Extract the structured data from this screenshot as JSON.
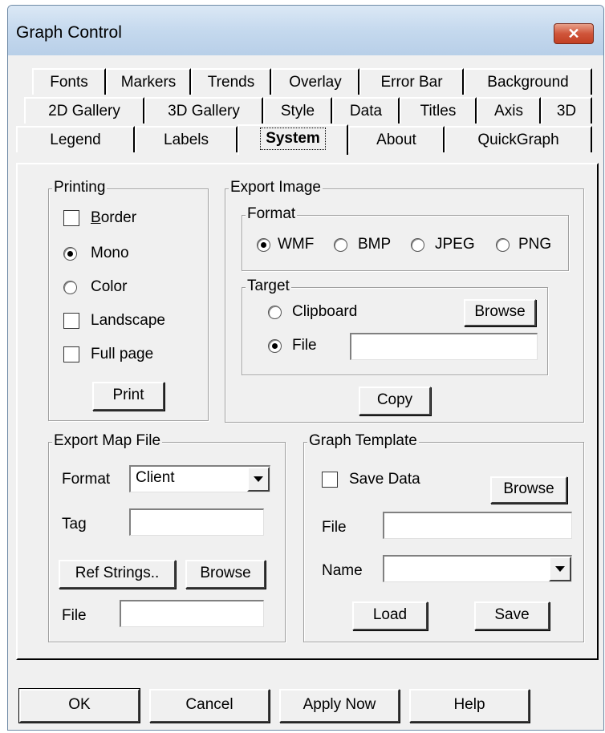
{
  "window": {
    "title": "Graph Control",
    "close_glyph": "✕"
  },
  "tabs": {
    "row1": [
      "Fonts",
      "Markers",
      "Trends",
      "Overlay",
      "Error Bar",
      "Background"
    ],
    "row2": [
      "2D Gallery",
      "3D Gallery",
      "Style",
      "Data",
      "Titles",
      "Axis",
      "3D"
    ],
    "row3": [
      "Legend",
      "Labels",
      "System",
      "About",
      "QuickGraph"
    ],
    "active": "System"
  },
  "printing": {
    "title": "Printing",
    "border": {
      "label": "Border",
      "checked": false
    },
    "mono": {
      "label": "Mono",
      "selected": true
    },
    "color": {
      "label": "Color",
      "selected": false
    },
    "landscape": {
      "label": "Landscape",
      "checked": false
    },
    "full_page": {
      "label": "Full page",
      "checked": false
    },
    "print_button": "Print"
  },
  "export_image": {
    "title": "Export Image",
    "format_title": "Format",
    "formats": [
      "WMF",
      "BMP",
      "JPEG",
      "PNG"
    ],
    "selected_format": "WMF",
    "target_title": "Target",
    "clipboard_label": "Clipboard",
    "file_label": "File",
    "selected_target": "File",
    "file_value": "",
    "browse_button": "Browse",
    "copy_button": "Copy"
  },
  "export_map": {
    "title": "Export Map File",
    "format_label": "Format",
    "format_value": "Client",
    "tag_label": "Tag",
    "tag_value": "",
    "ref_strings_button": "Ref Strings..",
    "browse_button": "Browse",
    "file_label": "File",
    "file_value": ""
  },
  "graph_template": {
    "title": "Graph Template",
    "save_data_label": "Save Data",
    "save_data_checked": false,
    "browse_button": "Browse",
    "file_label": "File",
    "file_value": "",
    "name_label": "Name",
    "name_value": "",
    "load_button": "Load",
    "save_button": "Save"
  },
  "footer": {
    "ok": "OK",
    "cancel": "Cancel",
    "apply_now": "Apply Now",
    "help": "Help"
  }
}
